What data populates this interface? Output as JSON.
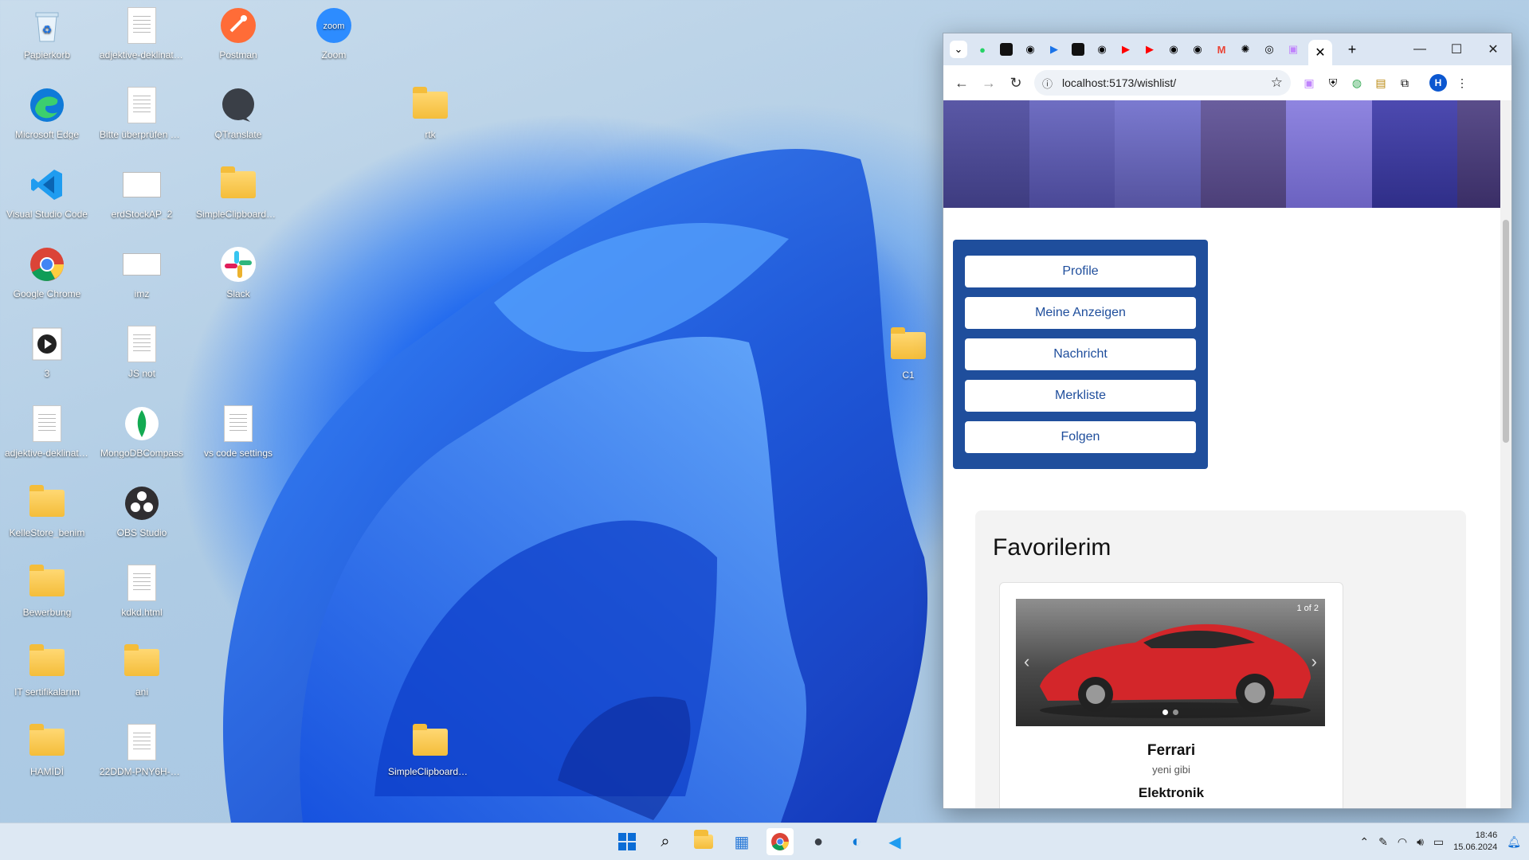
{
  "desktop": {
    "icons": [
      {
        "label": "Papierkorb",
        "icon": "recycle-bin-icon"
      },
      {
        "label": "adjektive-deklinatio...",
        "icon": "spreadsheet-file-icon"
      },
      {
        "label": "Postman",
        "icon": "postman-icon"
      },
      {
        "label": "Zoom",
        "icon": "zoom-icon"
      },
      {
        "label": "Microsoft Edge",
        "icon": "edge-icon"
      },
      {
        "label": "Bitte überprüfen Sie",
        "icon": "text-file-icon"
      },
      {
        "label": "QTranslate",
        "icon": "qtranslate-icon"
      },
      {
        "label": "rtk",
        "icon": "folder-icon"
      },
      {
        "label": "Visual Studio Code",
        "icon": "vscode-icon"
      },
      {
        "label": "erdStockAP_2",
        "icon": "image-file-icon"
      },
      {
        "label": "SimpleClipboardEdi...",
        "icon": "folder-icon"
      },
      {
        "label": "Google Chrome",
        "icon": "chrome-icon"
      },
      {
        "label": "imz",
        "icon": "image-file-icon"
      },
      {
        "label": "Slack",
        "icon": "slack-icon"
      },
      {
        "label": "3",
        "icon": "media-file-icon"
      },
      {
        "label": "JS not",
        "icon": "document-file-icon"
      },
      {
        "label": "C1",
        "icon": "folder-icon"
      },
      {
        "label": "adjektive-deklinatio...",
        "icon": "spreadsheet-file-icon"
      },
      {
        "label": "MongoDBCompass",
        "icon": "mongodb-icon"
      },
      {
        "label": "vs code settings",
        "icon": "text-file-icon"
      },
      {
        "label": "KelleStore_benim",
        "icon": "folder-icon"
      },
      {
        "label": "OBS Studio",
        "icon": "obs-icon"
      },
      {
        "label": "Bewerbung",
        "icon": "folder-icon"
      },
      {
        "label": "kdkd.html",
        "icon": "text-file-icon"
      },
      {
        "label": "IT sertifikalarım",
        "icon": "folder-icon"
      },
      {
        "label": "ani",
        "icon": "folder-icon"
      },
      {
        "label": "HAMİDİ",
        "icon": "folder-icon"
      },
      {
        "label": "22DDM-PNY6H-D...",
        "icon": "text-file-icon"
      },
      {
        "label": "SimpleClipboardEdi...",
        "icon": "folder-icon"
      }
    ]
  },
  "browser": {
    "url": "localhost:5173/wishlist/",
    "avatar_initial": "H",
    "active_tab_close": "✕",
    "new_tab": "+",
    "window_controls": {
      "minimize": "—",
      "maximize": "☐",
      "close": "✕"
    }
  },
  "page": {
    "menu": [
      "Profile",
      "Meine Anzeigen",
      "Nachricht",
      "Merkliste",
      "Folgen"
    ],
    "favorites_title": "Favorilerim",
    "card": {
      "counter": "1 of 2",
      "title": "Ferrari",
      "subtitle": "yeni gibi",
      "category": "Elektronik"
    }
  },
  "taskbar": {
    "time": "18:46",
    "date": "15.06.2024"
  },
  "colors": {
    "nav_blue": "#1f4e9c",
    "car_red": "#d3262a"
  }
}
